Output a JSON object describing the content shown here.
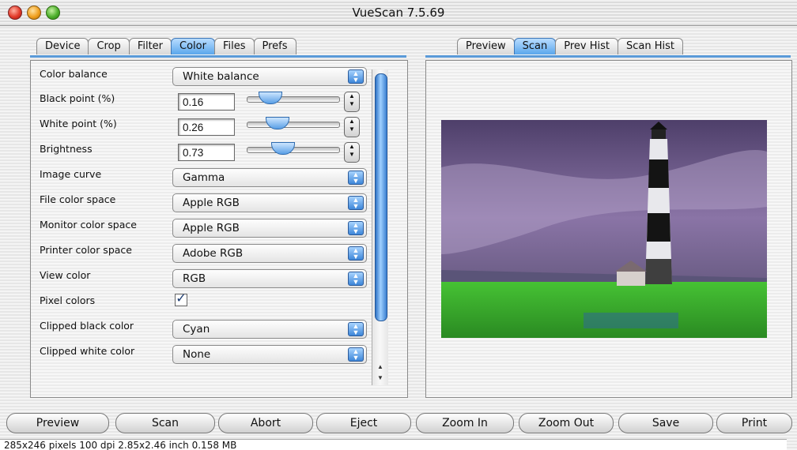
{
  "window": {
    "title": "VueScan 7.5.69"
  },
  "left_tabs": [
    "Device",
    "Crop",
    "Filter",
    "Color",
    "Files",
    "Prefs"
  ],
  "left_active": "Color",
  "right_tabs": [
    "Preview",
    "Scan",
    "Prev Hist",
    "Scan Hist"
  ],
  "right_active": "Scan",
  "settings": {
    "color_balance": {
      "label": "Color balance",
      "value": "White balance"
    },
    "black_point": {
      "label": "Black point (%)",
      "value": "0.16",
      "level": 0.16
    },
    "white_point": {
      "label": "White point (%)",
      "value": "0.26",
      "level": 0.26
    },
    "brightness": {
      "label": "Brightness",
      "value": "0.73",
      "level": 0.34
    },
    "image_curve": {
      "label": "Image curve",
      "value": "Gamma"
    },
    "file_color_space": {
      "label": "File color space",
      "value": "Apple RGB"
    },
    "monitor_color_space": {
      "label": "Monitor color space",
      "value": "Apple RGB"
    },
    "printer_color_space": {
      "label": "Printer color space",
      "value": "Adobe RGB"
    },
    "view_color": {
      "label": "View color",
      "value": "RGB"
    },
    "pixel_colors": {
      "label": "Pixel colors",
      "checked": true
    },
    "clipped_black": {
      "label": "Clipped black color",
      "value": "Cyan"
    },
    "clipped_white": {
      "label": "Clipped white color",
      "value": "None"
    }
  },
  "buttons": {
    "preview": "Preview",
    "scan": "Scan",
    "abort": "Abort",
    "eject": "Eject",
    "zoom_in": "Zoom In",
    "zoom_out": "Zoom Out",
    "save": "Save",
    "print": "Print"
  },
  "status": "285x246 pixels 100 dpi 2.85x2.46 inch 0.158 MB",
  "colors": {
    "accent": "#5aa6ec",
    "sky": "#7a5c9a",
    "grass": "#3ab82a"
  }
}
